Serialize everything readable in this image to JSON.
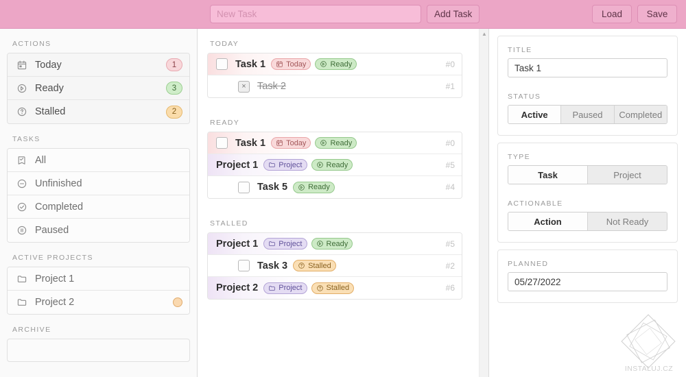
{
  "topbar": {
    "new_task_placeholder": "New Task",
    "new_task_value": "",
    "add_task_label": "Add Task",
    "load_label": "Load",
    "save_label": "Save"
  },
  "sidebar": {
    "sections": [
      {
        "heading": "ACTIONS",
        "items": [
          {
            "label": "Today",
            "icon": "calendar-icon",
            "badge": "1",
            "badge_color": "red",
            "badge_hex": "#f8d7da"
          },
          {
            "label": "Ready",
            "icon": "play-circle-icon",
            "badge": "3",
            "badge_color": "green",
            "badge_hex": "#cfedc9"
          },
          {
            "label": "Stalled",
            "icon": "question-circle-icon",
            "badge": "2",
            "badge_color": "amber",
            "badge_hex": "#fadcab"
          }
        ]
      },
      {
        "heading": "TASKS",
        "items": [
          {
            "label": "All",
            "icon": "checklist-icon",
            "badge": "",
            "badge_color": ""
          },
          {
            "label": "Unfinished",
            "icon": "minus-circle-icon",
            "badge": "",
            "badge_color": ""
          },
          {
            "label": "Completed",
            "icon": "check-circle-icon",
            "badge": "",
            "badge_color": ""
          },
          {
            "label": "Paused",
            "icon": "pause-circle-icon",
            "badge": "",
            "badge_color": ""
          }
        ]
      },
      {
        "heading": "ACTIVE PROJECTS",
        "items": [
          {
            "label": "Project 1",
            "icon": "folder-icon",
            "badge": "",
            "badge_color": ""
          },
          {
            "label": "Project 2",
            "icon": "folder-icon",
            "badge": "dot",
            "badge_color": "amber"
          }
        ]
      },
      {
        "heading": "ARCHIVE",
        "items": []
      }
    ]
  },
  "main": {
    "groups": [
      {
        "heading": "TODAY",
        "rows": [
          {
            "title": "Task 1",
            "id": "#0",
            "indent": 0,
            "tint": "today",
            "checkbox": "empty",
            "completed": false,
            "chips": [
              {
                "label": "Today",
                "kind": "today",
                "icon": "calendar-icon"
              },
              {
                "label": "Ready",
                "kind": "ready",
                "icon": "play-circle-icon"
              }
            ]
          },
          {
            "title": "Task 2",
            "id": "#1",
            "indent": 1,
            "tint": "none",
            "checkbox": "x",
            "completed": true,
            "chips": []
          }
        ]
      },
      {
        "heading": "READY",
        "rows": [
          {
            "title": "Task 1",
            "id": "#0",
            "indent": 0,
            "tint": "today",
            "checkbox": "empty",
            "completed": false,
            "chips": [
              {
                "label": "Today",
                "kind": "today",
                "icon": "calendar-icon"
              },
              {
                "label": "Ready",
                "kind": "ready",
                "icon": "play-circle-icon"
              }
            ]
          },
          {
            "title": "Project 1",
            "id": "#5",
            "indent": 0,
            "tint": "project",
            "checkbox": "none",
            "completed": false,
            "chips": [
              {
                "label": "Project",
                "kind": "project",
                "icon": "folder-icon"
              },
              {
                "label": "Ready",
                "kind": "ready",
                "icon": "play-circle-icon"
              }
            ]
          },
          {
            "title": "Task 5",
            "id": "#4",
            "indent": 1,
            "tint": "none",
            "checkbox": "empty",
            "completed": false,
            "chips": [
              {
                "label": "Ready",
                "kind": "ready",
                "icon": "play-circle-icon"
              }
            ]
          }
        ]
      },
      {
        "heading": "STALLED",
        "rows": [
          {
            "title": "Project 1",
            "id": "#5",
            "indent": 0,
            "tint": "project",
            "checkbox": "none",
            "completed": false,
            "chips": [
              {
                "label": "Project",
                "kind": "project",
                "icon": "folder-icon"
              },
              {
                "label": "Ready",
                "kind": "ready",
                "icon": "play-circle-icon"
              }
            ]
          },
          {
            "title": "Task 3",
            "id": "#2",
            "indent": 1,
            "tint": "none",
            "checkbox": "empty",
            "completed": false,
            "chips": [
              {
                "label": "Stalled",
                "kind": "stalled",
                "icon": "question-circle-icon"
              }
            ]
          },
          {
            "title": "Project 2",
            "id": "#6",
            "indent": 0,
            "tint": "project",
            "checkbox": "none",
            "completed": false,
            "chips": [
              {
                "label": "Project",
                "kind": "project",
                "icon": "folder-icon"
              },
              {
                "label": "Stalled",
                "kind": "stalled",
                "icon": "question-circle-icon"
              }
            ]
          }
        ]
      }
    ]
  },
  "detail": {
    "title_label": "TITLE",
    "title_value": "Task 1",
    "status_label": "STATUS",
    "status_options": [
      "Active",
      "Paused",
      "Completed"
    ],
    "status_selected": "Active",
    "type_label": "TYPE",
    "type_options": [
      "Task",
      "Project"
    ],
    "type_selected": "Task",
    "actionable_label": "ACTIONABLE",
    "actionable_options": [
      "Action",
      "Not Ready"
    ],
    "actionable_selected": "Action",
    "planned_label": "PLANNED",
    "planned_value": "05/27/2022"
  },
  "watermark": {
    "text": "INSTALUJ.CZ"
  },
  "colors": {
    "topbar_bg": "#eca6c6",
    "accent_red": "#f8d7da",
    "accent_green": "#cfedc9",
    "accent_amber": "#fadcab",
    "accent_purple": "#e4dcf3"
  }
}
